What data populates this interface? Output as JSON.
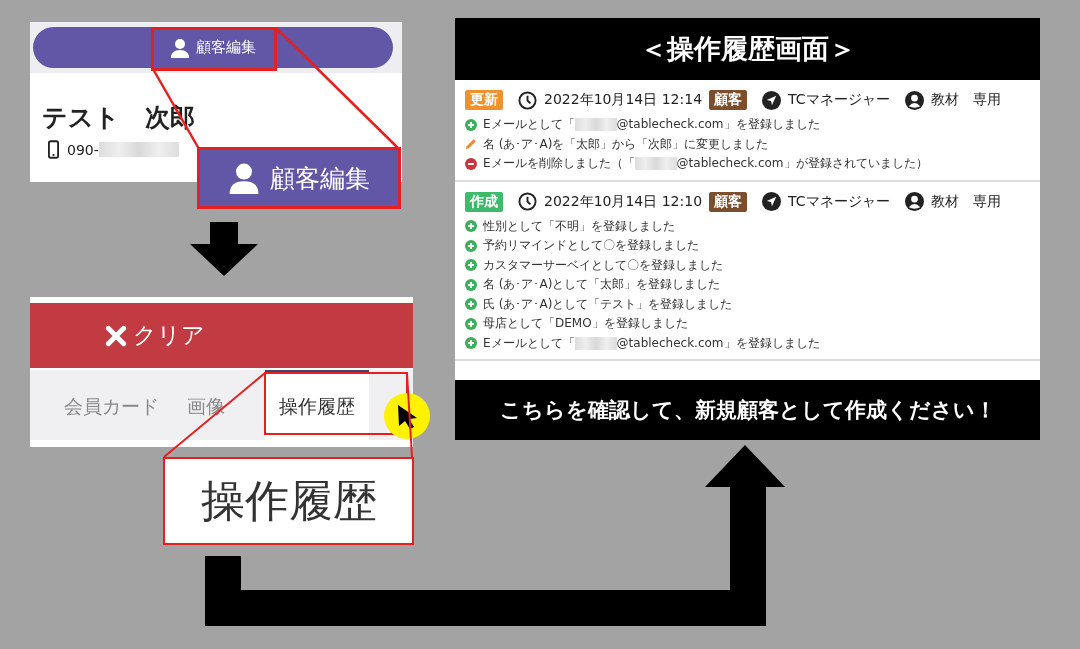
{
  "profile_card": {
    "edit_button": {
      "label": "顧客編集"
    },
    "name": "テスト　次郎",
    "phone": "090-"
  },
  "zoomed_edit_button": {
    "label": "顧客編集"
  },
  "tab_panel": {
    "clear_button": {
      "label": "クリア"
    },
    "tabs": [
      {
        "label": "会員カード",
        "selected": false
      },
      {
        "label": "画像",
        "selected": false
      },
      {
        "label": "操作履歴",
        "selected": true
      }
    ]
  },
  "zoomed_tab": {
    "label": "操作履歴"
  },
  "history_panel": {
    "title": "＜操作履歴画面＞",
    "entries": [
      {
        "action": "更新",
        "color": "#f0922b",
        "datetime": "2022年10月14日 12:14",
        "category": "顧客",
        "operator": "TCマネージャー",
        "account": "教材　専用",
        "changes": [
          {
            "kind": "add",
            "text": "Eメールとして「",
            "redacted": true,
            "text_after": "@tablecheck.com」を登録しました"
          },
          {
            "kind": "edit",
            "text": "名 (あ･ア･A)を「太郎」から「次郎」に変更しました",
            "redacted": false
          },
          {
            "kind": "remove",
            "text": "Eメールを削除しました（「",
            "redacted": true,
            "text_after": "@tablecheck.com」が登録されていました）"
          }
        ]
      },
      {
        "action": "作成",
        "color": "#3dbb6b",
        "datetime": "2022年10月14日 12:10",
        "category": "顧客",
        "operator": "TCマネージャー",
        "account": "教材　専用",
        "changes": [
          {
            "kind": "add",
            "text": "性別として「不明」を登録しました",
            "redacted": false
          },
          {
            "kind": "add",
            "text": "予約リマインドとして〇を登録しました",
            "redacted": false
          },
          {
            "kind": "add",
            "text": "カスタマーサーベイとして〇を登録しました",
            "redacted": false
          },
          {
            "kind": "add",
            "text": "名 (あ･ア･A)として「太郎」を登録しました",
            "redacted": false
          },
          {
            "kind": "add",
            "text": "氏 (あ･ア･A)として「テスト」を登録しました",
            "redacted": false
          },
          {
            "kind": "add",
            "text": "母店として「DEMO」を登録しました",
            "redacted": false
          },
          {
            "kind": "add",
            "text": "Eメールとして「",
            "redacted": true,
            "text_after": "@tablecheck.com」を登録しました"
          }
        ]
      }
    ],
    "footer": "こちらを確認して、新規顧客として作成ください！"
  }
}
